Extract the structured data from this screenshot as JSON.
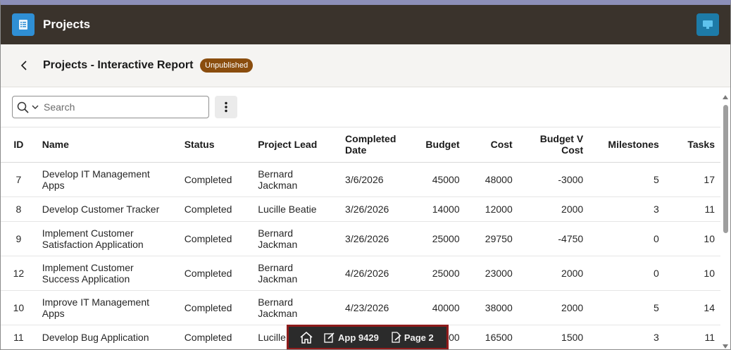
{
  "header": {
    "app_title": "Projects",
    "logo_icon": "report-list-icon",
    "user_icon": "chat-icon"
  },
  "title_region": {
    "title": "Projects - Interactive Report",
    "badge": "Unpublished",
    "badge_color": "#8a4d0e"
  },
  "search": {
    "placeholder": "Search",
    "value": ""
  },
  "table": {
    "columns": [
      "ID",
      "Name",
      "Status",
      "Project Lead",
      "Completed Date",
      "Budget",
      "Cost",
      "Budget V Cost",
      "Milestones",
      "Tasks"
    ],
    "rows": [
      {
        "id": "7",
        "name": "Develop IT Management Apps",
        "status": "Completed",
        "lead": "Bernard Jackman",
        "date": "3/6/2026",
        "budget": "45000",
        "cost": "48000",
        "bvc": "-3000",
        "milestones": "5",
        "tasks": "17"
      },
      {
        "id": "8",
        "name": "Develop Customer Tracker",
        "status": "Completed",
        "lead": "Lucille Beatie",
        "date": "3/26/2026",
        "budget": "14000",
        "cost": "12000",
        "bvc": "2000",
        "milestones": "3",
        "tasks": "11"
      },
      {
        "id": "9",
        "name": "Implement Customer Satisfaction Application",
        "status": "Completed",
        "lead": "Bernard Jackman",
        "date": "3/26/2026",
        "budget": "25000",
        "cost": "29750",
        "bvc": "-4750",
        "milestones": "0",
        "tasks": "10"
      },
      {
        "id": "12",
        "name": "Implement Customer Success Application",
        "status": "Completed",
        "lead": "Bernard Jackman",
        "date": "4/26/2026",
        "budget": "25000",
        "cost": "23000",
        "bvc": "2000",
        "milestones": "0",
        "tasks": "10"
      },
      {
        "id": "10",
        "name": "Improve IT Management Apps",
        "status": "Completed",
        "lead": "Bernard Jackman",
        "date": "4/23/2026",
        "budget": "40000",
        "cost": "38000",
        "bvc": "2000",
        "milestones": "5",
        "tasks": "14"
      },
      {
        "id": "11",
        "name": "Develop Bug Application",
        "status": "Completed",
        "lead": "Lucille",
        "date": "",
        "budget": "000",
        "cost": "16500",
        "bvc": "1500",
        "milestones": "3",
        "tasks": "11"
      }
    ]
  },
  "dev_toolbar": {
    "home_icon": "home-icon",
    "app_label": "App 9429",
    "page_label": "Page 2"
  }
}
